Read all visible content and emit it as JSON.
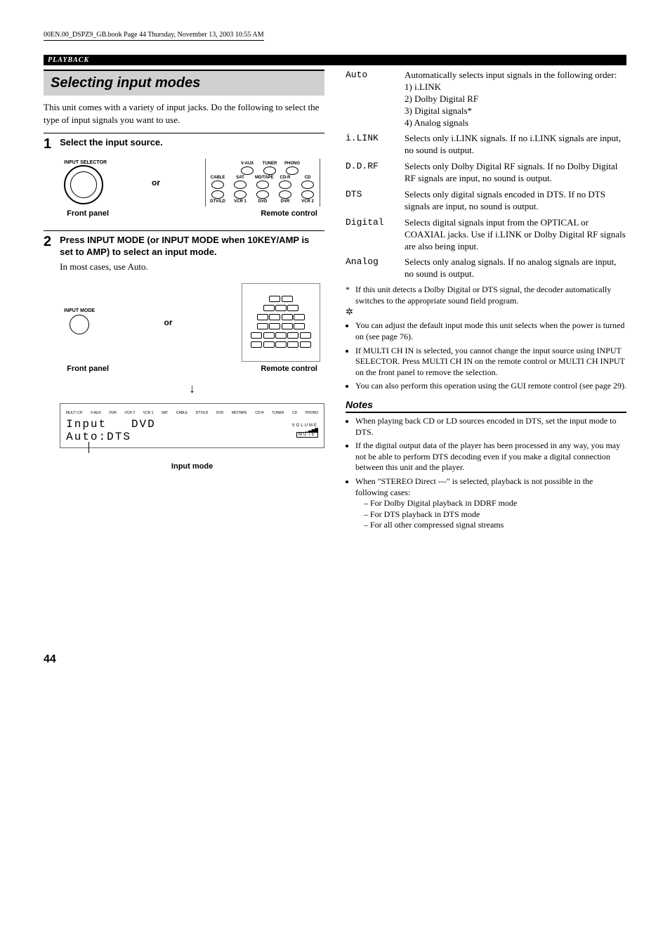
{
  "meta": {
    "book_line": "00EN.00_DSPZ9_GB.book  Page 44  Thursday, November 13, 2003  10:55 AM"
  },
  "header": {
    "section": "PLAYBACK"
  },
  "title": "Selecting input modes",
  "intro": "This unit comes with a variety of input jacks. Do the following to select the type of input signals you want to use.",
  "steps": [
    {
      "num": "1",
      "title": "Select the input source.",
      "dial_label": "INPUT SELECTOR",
      "or": "or",
      "remote_labels_top": [
        "V-AUX",
        "TUNER",
        "PHONO"
      ],
      "remote_labels_mid": [
        "CABLE",
        "SAT",
        "MD/TAPE",
        "CD-R",
        "CD"
      ],
      "remote_labels_bot": [
        "DTV/LD",
        "VCR 1",
        "DVD",
        "DVR",
        "VCR 2"
      ],
      "front_label": "Front panel",
      "remote_label": "Remote control"
    },
    {
      "num": "2",
      "title": "Press INPUT MODE (or INPUT MODE when 10KEY/AMP is set to AMP) to select an input mode.",
      "text": "In most cases, use Auto.",
      "knob_label": "INPUT MODE",
      "or": "or",
      "front_label": "Front panel",
      "remote_label": "Remote control"
    }
  ],
  "display": {
    "sources": [
      "MULTI CH",
      "V-AUX",
      "DVR",
      "VCR 2",
      "VCR 1",
      "SAT",
      "CABLE",
      "DTV/LD",
      "DVD",
      "MD/TAPE",
      "CD-R",
      "TUNER",
      "CD",
      "PHONO"
    ],
    "line1_left": "Input",
    "line1_right": "DVD",
    "line2": "Auto:DTS",
    "volume_label": "VOLUME",
    "mute_label": "MUTE",
    "caption": "Input mode"
  },
  "modes": [
    {
      "label": "Auto",
      "text": "Automatically selects input signals in the following order:",
      "list": [
        "1) i.LINK",
        "2) Dolby Digital RF",
        "3) Digital signals*",
        "4) Analog signals"
      ]
    },
    {
      "label": "i.LINK",
      "text": "Selects only i.LINK signals. If no i.LINK signals are input, no sound is output."
    },
    {
      "label": "D.D.RF",
      "text": "Selects only Dolby Digital RF signals. If no Dolby Digital RF signals are input, no sound is output."
    },
    {
      "label": "DTS",
      "text": "Selects only digital signals encoded in DTS. If no DTS signals are input, no sound is output."
    },
    {
      "label": "Digital",
      "text": "Selects digital signals input from the OPTICAL or COAXIAL jacks. Use if i.LINK or Dolby Digital RF signals are also being input."
    },
    {
      "label": "Analog",
      "text": "Selects only analog signals. If no analog signals are input, no sound is output."
    }
  ],
  "footnote": {
    "mark": "*",
    "text": "If this unit detects a Dolby Digital or DTS signal, the decoder automatically switches to the appropriate sound field program."
  },
  "tips": [
    "You can adjust the default input mode this unit selects when the power is turned on (see page 76).",
    "If MULTI CH IN is selected, you cannot change the input source using INPUT SELECTOR. Press MULTI CH IN on the remote control or MULTI CH INPUT on the front panel to remove the selection.",
    "You can also perform this operation using the GUI remote control (see page 29)."
  ],
  "notes": {
    "heading": "Notes",
    "items": [
      "When playing back CD or LD sources encoded in DTS, set the input mode to DTS.",
      "If the digital output data of the player has been processed in any way, you may not be able to perform DTS decoding even if you make a digital connection between this unit and the player.",
      "When \"STEREO Direct ---\" is selected, playback is not possible in the following cases:"
    ],
    "subitems": [
      "– For Dolby Digital playback in DDRF mode",
      "– For DTS playback in DTS mode",
      "– For all other compressed signal streams"
    ]
  },
  "page_number": "44"
}
